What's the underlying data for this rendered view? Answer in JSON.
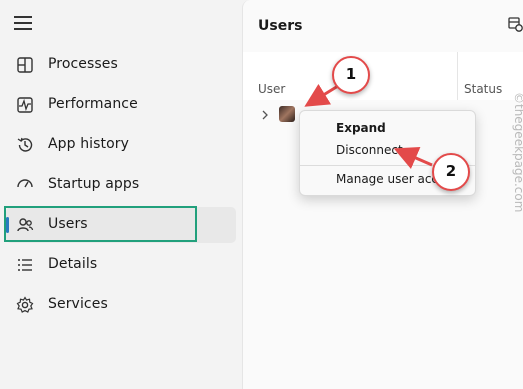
{
  "sidebar": {
    "items": [
      {
        "label": "Processes",
        "icon": "processes-icon"
      },
      {
        "label": "Performance",
        "icon": "performance-icon"
      },
      {
        "label": "App history",
        "icon": "app-history-icon"
      },
      {
        "label": "Startup apps",
        "icon": "startup-apps-icon"
      },
      {
        "label": "Users",
        "icon": "users-icon",
        "selected": true
      },
      {
        "label": "Details",
        "icon": "details-icon"
      },
      {
        "label": "Services",
        "icon": "services-icon"
      }
    ]
  },
  "main": {
    "title": "Users",
    "columns": {
      "user": "User",
      "status": "Status"
    }
  },
  "context_menu": {
    "items": [
      "Expand",
      "Disconnect",
      "Manage user accou"
    ]
  },
  "annotations": {
    "step1": "1",
    "step2": "2",
    "arrow_color": "#e34a4a",
    "highlight_color": "#21a07c"
  },
  "watermark": "©thegeekpage.com",
  "colors": {
    "accent": "#2a7bbf"
  }
}
